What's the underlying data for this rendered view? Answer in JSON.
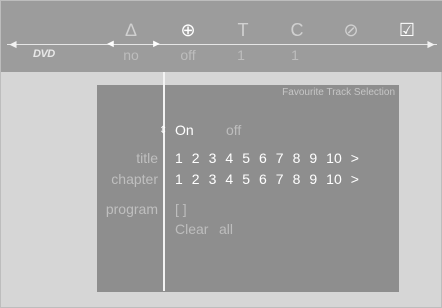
{
  "topbar": {
    "logo": "DVD",
    "icons": [
      {
        "name": "delta-icon",
        "glyph": "∆"
      },
      {
        "name": "zoom-icon",
        "glyph": "⊕"
      },
      {
        "name": "t-icon",
        "glyph": "T"
      },
      {
        "name": "c-icon",
        "glyph": "C"
      },
      {
        "name": "clock-icon",
        "glyph": "⊘"
      },
      {
        "name": "check-icon",
        "glyph": "☑"
      }
    ],
    "values": [
      "no",
      "off",
      "1",
      "1"
    ]
  },
  "panel": {
    "title": "Favourite  Track  Selection",
    "onoff": {
      "on": "On",
      "off": "off"
    },
    "title_label": "title",
    "chapter_label": "chapter",
    "program_label": "program",
    "numbers": [
      "1",
      "2",
      "3",
      "4",
      "5",
      "6",
      "7",
      "8",
      "9",
      "10",
      ">"
    ],
    "program_value": "[  ]",
    "clear": "Clear",
    "all": "all"
  }
}
